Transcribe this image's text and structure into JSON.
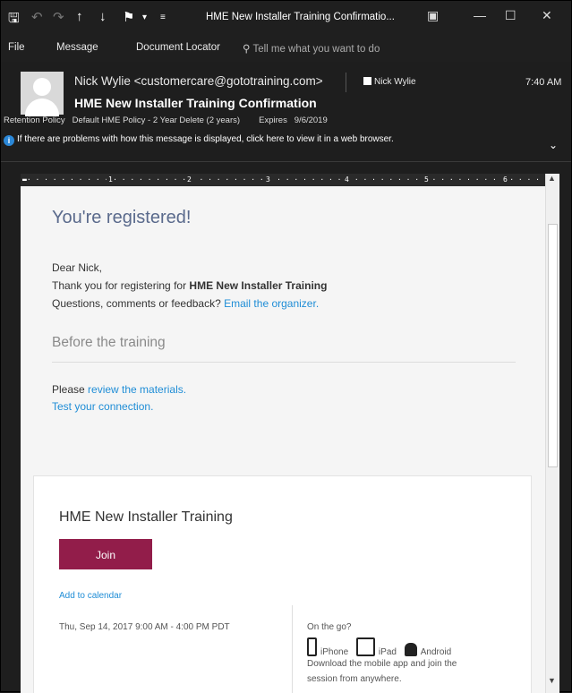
{
  "titlebar": {
    "title": "HME New Installer Training Confirmatio...",
    "icons": [
      "save-icon",
      "undo-icon",
      "redo-icon",
      "up-arrow-icon",
      "down-arrow-icon",
      "rules-icon",
      "more-icon"
    ]
  },
  "menu": {
    "file": "File",
    "message": "Message",
    "document_locator": "Document Locator",
    "tell_me": "Tell me what you want to do"
  },
  "header": {
    "from": "Nick Wylie <customercare@gototraining.com>",
    "to": "Nick Wylie",
    "time": "7:40 AM",
    "subject": "HME New Installer Training Confirmation",
    "retention_label": "Retention Policy",
    "retention_value": "Default HME Policy - 2 Year Delete (2 years)",
    "expires_label": "Expires",
    "expires_value": "9/6/2019",
    "info": "If there are problems with how this message is displayed, click here to view it in a web browser."
  },
  "ruler": {
    "marks": [
      "1",
      "2",
      "3",
      "4",
      "5",
      "6"
    ]
  },
  "email": {
    "registered": "You're registered!",
    "dear": "Dear Nick,",
    "thanks_prefix": "Thank you for registering for ",
    "thanks_bold": "HME New Installer Training",
    "questions_prefix": "Questions, comments or feedback? ",
    "questions_link": "Email the organizer.",
    "before": "Before the training",
    "please_prefix": "Please ",
    "please_link": "review the materials.",
    "test_link": "Test your connection."
  },
  "card": {
    "title": "HME New Installer Training",
    "join": "Join",
    "add_calendar": "Add to calendar",
    "datetime": "Thu, Sep 14, 2017 9:00 AM - 4:00 PM PDT",
    "on_the_go": "On the go?",
    "iphone": "iPhone",
    "ipad": "iPad",
    "android": "Android",
    "download": "Download the mobile app and join the session from anywhere."
  },
  "colors": {
    "accent": "#1f8dd6",
    "join_button": "#921d4a",
    "heading": "#5a6a8c"
  }
}
